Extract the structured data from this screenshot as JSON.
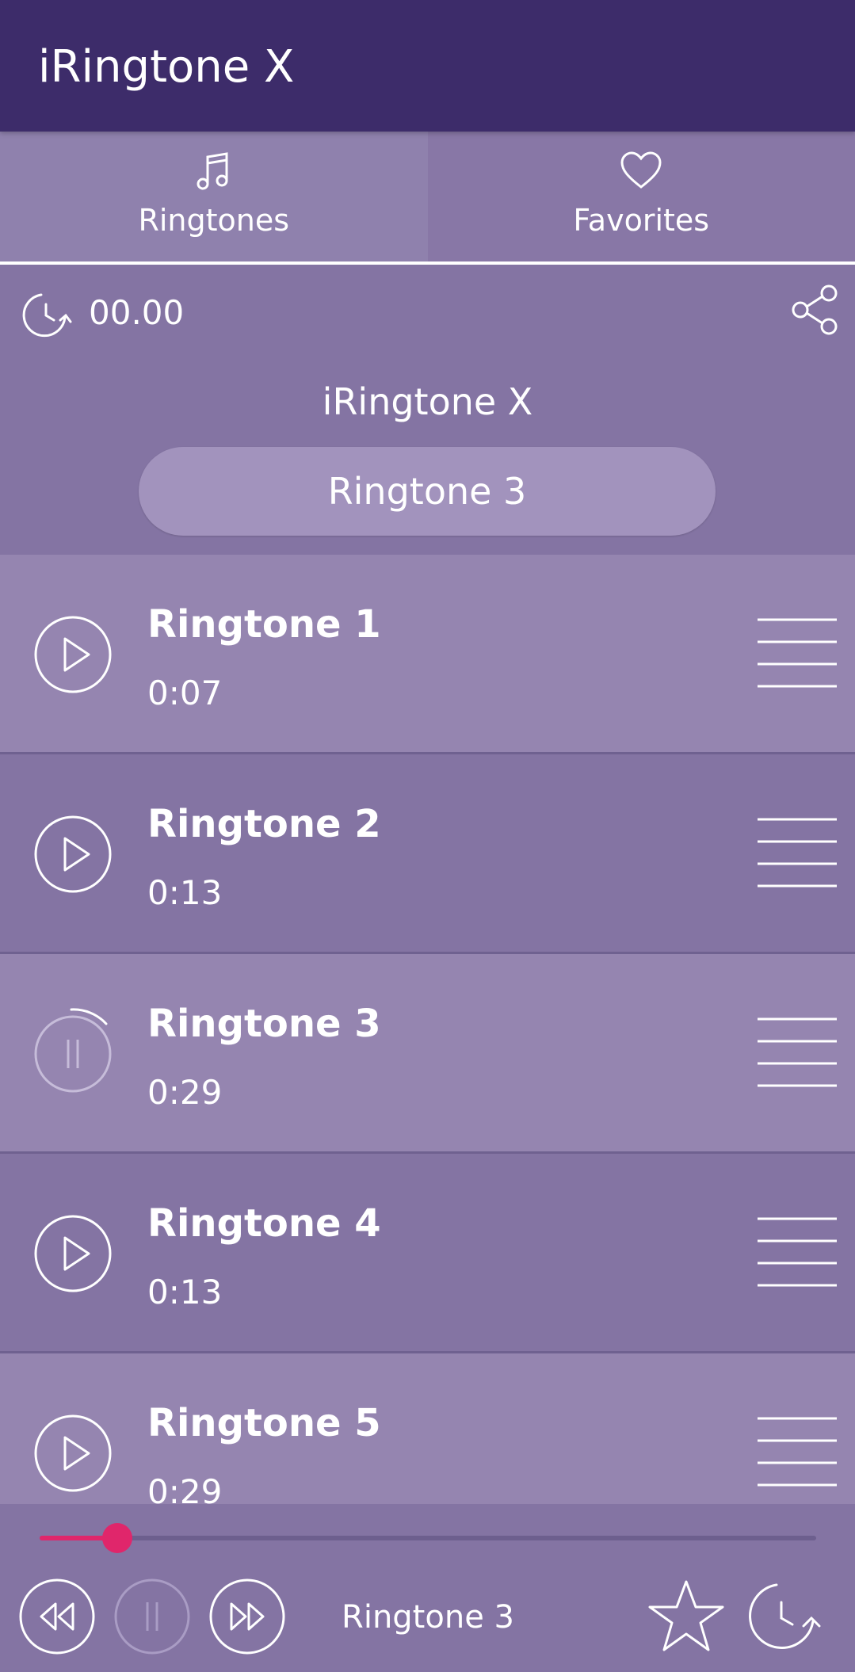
{
  "app": {
    "title": "iRingtone X"
  },
  "tabs": [
    {
      "label": "Ringtones",
      "icon": "music-note-icon",
      "active": true
    },
    {
      "label": "Favorites",
      "icon": "heart-icon",
      "active": false
    }
  ],
  "now_panel": {
    "timer": "00.00",
    "app_name": "iRingtone X",
    "current": "Ringtone 3"
  },
  "ringtones": [
    {
      "name": "Ringtone 1",
      "duration": "0:07",
      "state": "play"
    },
    {
      "name": "Ringtone 2",
      "duration": "0:13",
      "state": "play"
    },
    {
      "name": "Ringtone 3",
      "duration": "0:29",
      "state": "loading"
    },
    {
      "name": "Ringtone 4",
      "duration": "0:13",
      "state": "play"
    },
    {
      "name": "Ringtone 5",
      "duration": "0:29",
      "state": "play"
    }
  ],
  "player": {
    "now_playing": "Ringtone 3",
    "progress": 0.1
  },
  "colors": {
    "appbar": "#3d2c6a",
    "background": "#8474a3",
    "row_light": "#9585b0",
    "accent": "#e0266b"
  }
}
